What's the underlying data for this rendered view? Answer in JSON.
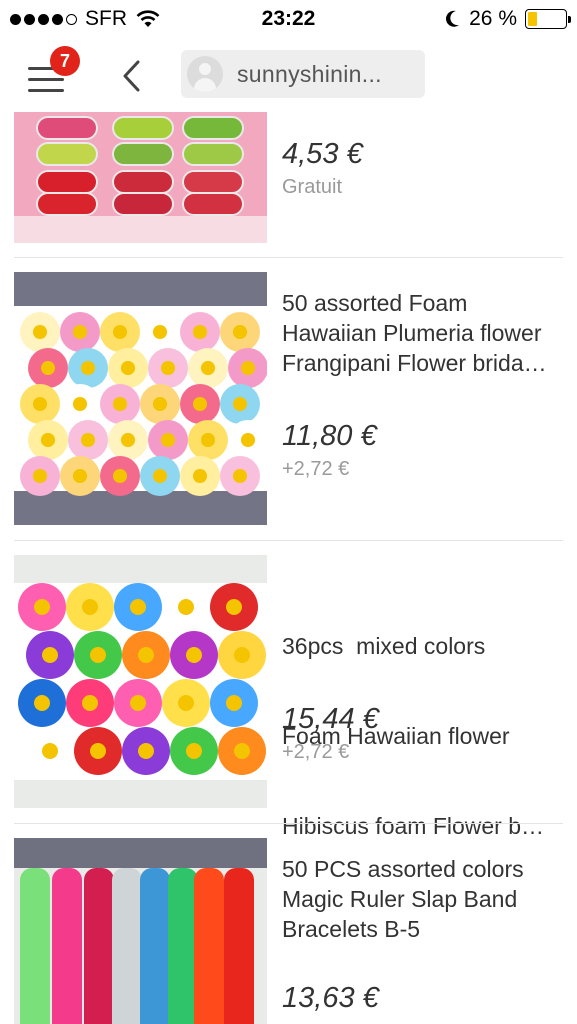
{
  "status_bar": {
    "carrier": "SFR",
    "time": "23:22",
    "battery": "26 %",
    "battery_level": 0.26
  },
  "nav": {
    "notification_count": "7",
    "search_text": "sunnyshinin..."
  },
  "colors": {
    "badge": "#e2231a",
    "battery": "#f5c300",
    "shipping_text": "#9a9a9a"
  },
  "listings": [
    {
      "title": "",
      "price": "4,53 €",
      "shipping": "Gratuit"
    },
    {
      "title_lines": [
        "50 assorted Foam",
        "Hawaiian Plumeria flower",
        "Frangipani Flower brida…"
      ],
      "price": "11,80 €",
      "shipping": "+2,72 €"
    },
    {
      "title_lines": [
        "36pcs  mixed colors",
        "Foam Hawaiian flower",
        "Hibiscus foam Flower b…"
      ],
      "price": "15,44 €",
      "shipping": "+2,72 €"
    },
    {
      "title_lines": [
        "50 PCS assorted colors",
        "Magic Ruler Slap Band",
        "Bracelets B-5"
      ],
      "price": "13,63 €",
      "shipping": ""
    }
  ]
}
